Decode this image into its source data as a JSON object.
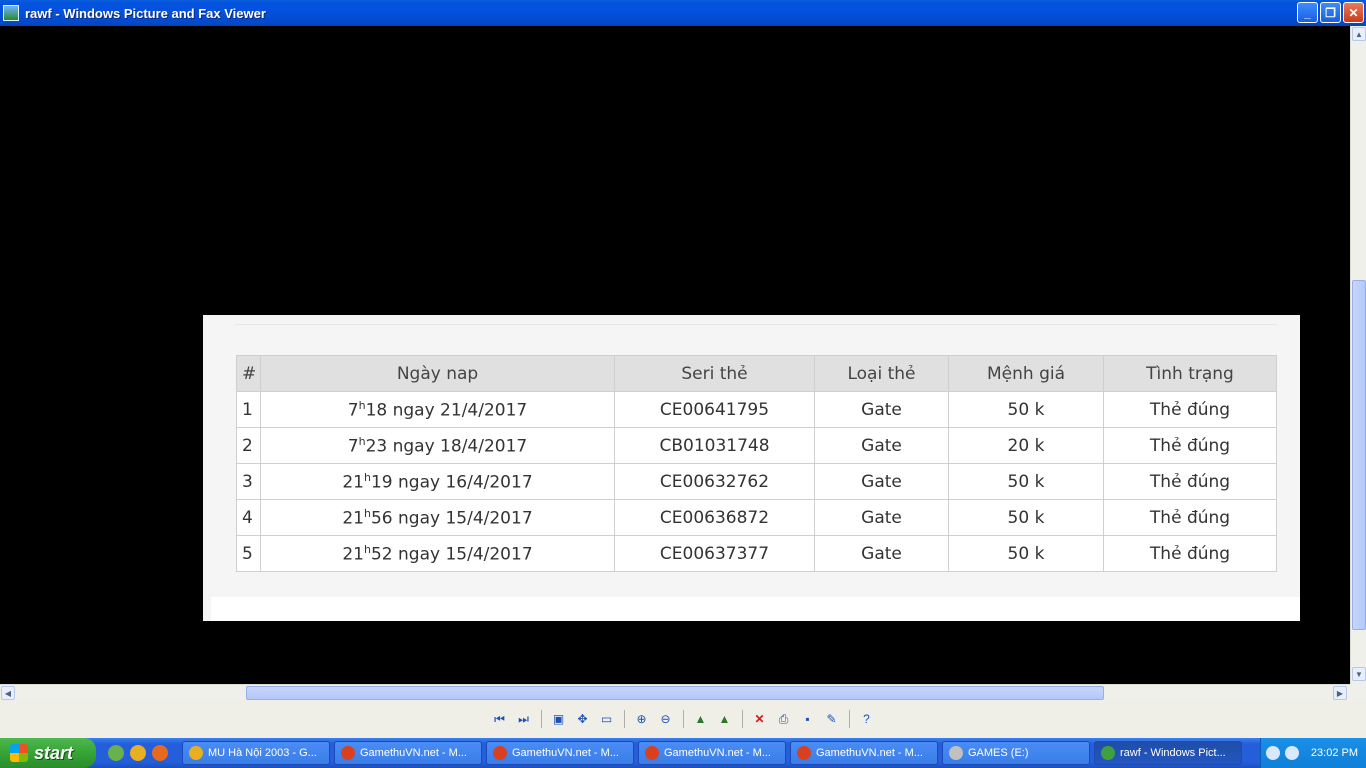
{
  "window": {
    "title": "rawf - Windows Picture and Fax Viewer",
    "buttons": {
      "minimize": "_",
      "maximize": "❐",
      "close": "✕"
    }
  },
  "table": {
    "headers": [
      "#",
      "Ngày nap",
      "Seri thẻ",
      "Loại thẻ",
      "Mệnh giá",
      "Tình trạng"
    ],
    "rows": [
      {
        "num": "1",
        "hour": "7",
        "sup": "h",
        "rest": "18 ngay 21/4/2017",
        "seri": "CE00641795",
        "loai": "Gate",
        "menh_gia": "50 k",
        "tinh_trang": "Thẻ đúng"
      },
      {
        "num": "2",
        "hour": "7",
        "sup": "h",
        "rest": "23 ngay 18/4/2017",
        "seri": "CB01031748",
        "loai": "Gate",
        "menh_gia": "20 k",
        "tinh_trang": "Thẻ đúng"
      },
      {
        "num": "3",
        "hour": "21",
        "sup": "h",
        "rest": "19 ngay 16/4/2017",
        "seri": "CE00632762",
        "loai": "Gate",
        "menh_gia": "50 k",
        "tinh_trang": "Thẻ đúng"
      },
      {
        "num": "4",
        "hour": "21",
        "sup": "h",
        "rest": "56 ngay 15/4/2017",
        "seri": "CE00636872",
        "loai": "Gate",
        "menh_gia": "50 k",
        "tinh_trang": "Thẻ đúng"
      },
      {
        "num": "5",
        "hour": "21",
        "sup": "h",
        "rest": "52 ngay 15/4/2017",
        "seri": "CE00637377",
        "loai": "Gate",
        "menh_gia": "50 k",
        "tinh_trang": "Thẻ đúng"
      }
    ]
  },
  "toolbar": {
    "icons": [
      "previous-image-icon",
      "next-image-icon",
      "best-fit-icon",
      "actual-size-icon",
      "slideshow-icon",
      "zoom-in-icon",
      "zoom-out-icon",
      "rotate-clockwise-icon",
      "rotate-counterclockwise-icon",
      "delete-icon",
      "print-icon",
      "save-icon",
      "edit-icon",
      "help-icon"
    ]
  },
  "taskbar": {
    "start_label": "start",
    "tasks": [
      {
        "label": "MU Hà Nội 2003 - G...",
        "color": "#e8b020"
      },
      {
        "label": "GamethuVN.net - M...",
        "color": "#d84020"
      },
      {
        "label": "GamethuVN.net - M...",
        "color": "#d84020"
      },
      {
        "label": "GamethuVN.net - M...",
        "color": "#d84020"
      },
      {
        "label": "GamethuVN.net - M...",
        "color": "#d84020"
      },
      {
        "label": "GAMES (E:)",
        "color": "#c0c0c0"
      },
      {
        "label": "rawf - Windows Pict...",
        "color": "#40a040"
      }
    ],
    "clock": "23:02 PM"
  }
}
